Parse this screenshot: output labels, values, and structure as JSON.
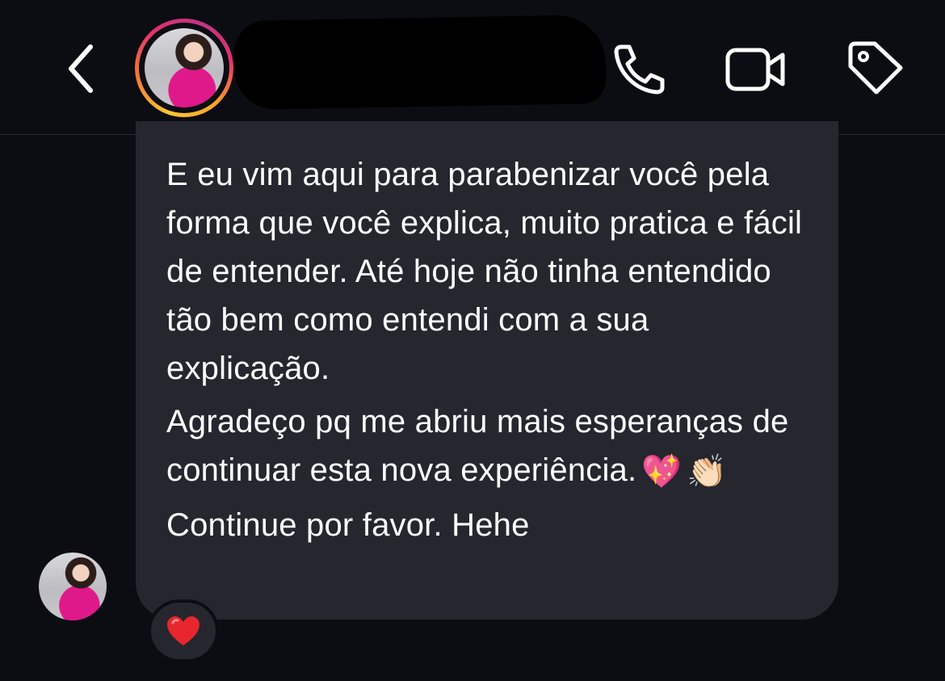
{
  "header": {
    "back_icon": "chevron-left-icon",
    "contact_name_redacted": true,
    "actions": [
      {
        "name": "voice-call",
        "icon": "phone-icon"
      },
      {
        "name": "video-call",
        "icon": "video-camera-icon"
      },
      {
        "name": "tag",
        "icon": "tag-icon"
      }
    ]
  },
  "message": {
    "paragraph_1": "E eu vim aqui para parabenizar você pela forma que você explica, muito pratica e fácil de entender. Até hoje não tinha entendido tão bem como entendi com a sua explicação.",
    "paragraph_2": "Agradeço pq me abriu mais esperanças de continuar esta nova experiência.",
    "emoji_1": "💖",
    "emoji_2": "👏🏻",
    "paragraph_3": "Continue por favor. Hehe",
    "reaction": "❤️"
  },
  "colors": {
    "background": "#0c0d12",
    "bubble": "#25262e",
    "text": "#ffffff",
    "reaction_heart": "#e8262d"
  }
}
